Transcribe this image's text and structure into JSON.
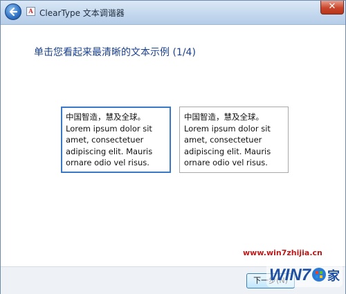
{
  "window": {
    "title": "ClearType 文本调谐器",
    "close_glyph": "✕"
  },
  "heading": "单击您看起来最清晰的文本示例 (1/4)",
  "samples": [
    {
      "lines": [
        "中国智造，慧及全球。",
        "Lorem ipsum dolor sit",
        "amet, consectetuer",
        "adipiscing elit. Mauris",
        "ornare odio vel risus."
      ],
      "selected": true
    },
    {
      "lines": [
        "中国智造，慧及全球。",
        "Lorem ipsum dolor sit",
        "amet, consectetuer",
        "adipiscing elit. Mauris",
        "ornare odio vel risus."
      ],
      "selected": false
    }
  ],
  "footer": {
    "next_label": "下一步(N)"
  },
  "watermark": {
    "url": "www.win7zhijia.cn",
    "logo_text": "WIN7之家"
  },
  "icons": {
    "back": "back-arrow-icon",
    "app": "cleartype-app-icon",
    "close": "close-icon"
  },
  "colors": {
    "heading": "#1a3f8c",
    "selected_border": "#3a78c7",
    "watermark": "#c01818"
  }
}
